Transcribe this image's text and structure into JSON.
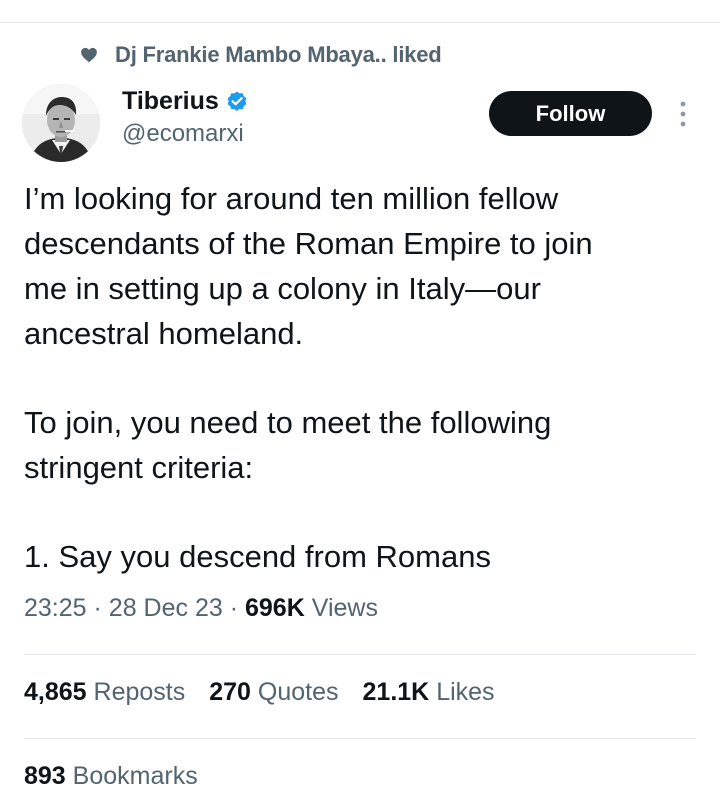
{
  "social_context": {
    "text": "Dj Frankie Mambo Mbaya.. liked",
    "icon": "heart-icon"
  },
  "author": {
    "name": "Tiberius",
    "handle": "@ecomarxi",
    "verified": true,
    "verified_color": "#1d9bf0"
  },
  "follow_button": {
    "label": "Follow"
  },
  "tweet": {
    "paragraphs": [
      [
        "I’m looking for around ten million fellow",
        "descendants of the Roman Empire to join",
        "me in setting up a colony in Italy—our",
        "ancestral homeland."
      ],
      [
        "To join, you need to meet the following",
        "stringent criteria:"
      ],
      [
        "1. Say you descend from Romans"
      ]
    ]
  },
  "meta": {
    "time": "23:25",
    "date": "28 Dec 23",
    "views_count": "696K",
    "views_label": "Views"
  },
  "stats": {
    "reposts_count": "4,865",
    "reposts_label": "Reposts",
    "quotes_count": "270",
    "quotes_label": "Quotes",
    "likes_count": "21.1K",
    "likes_label": "Likes",
    "bookmarks_count": "893",
    "bookmarks_label": "Bookmarks"
  },
  "colors": {
    "text_primary": "#0f1419",
    "text_secondary": "#536471",
    "divider": "#e6e9eb",
    "follow_bg": "#0f1419"
  }
}
